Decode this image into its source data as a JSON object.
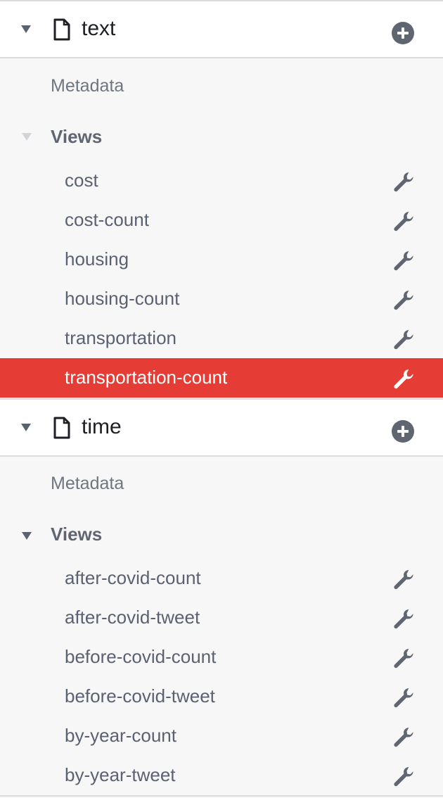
{
  "databases": [
    {
      "name": "text",
      "metadata_label": "Metadata",
      "views_label": "Views",
      "views": [
        "cost",
        "cost-count",
        "housing",
        "housing-count",
        "transportation",
        "transportation-count"
      ],
      "selected_view": "transportation-count"
    },
    {
      "name": "time",
      "metadata_label": "Metadata",
      "views_label": "Views",
      "views": [
        "after-covid-count",
        "after-covid-tweet",
        "before-covid-count",
        "before-covid-tweet",
        "by-year-count",
        "by-year-tweet"
      ]
    }
  ],
  "icons": {
    "expand": "caret-down-icon",
    "database": "file-icon",
    "add": "plus-circle-icon",
    "edit": "wrench-icon"
  },
  "colors": {
    "selected_bg": "#e53d36",
    "icon_gray": "#5f6671",
    "muted_caret": "#d2d4d8"
  }
}
